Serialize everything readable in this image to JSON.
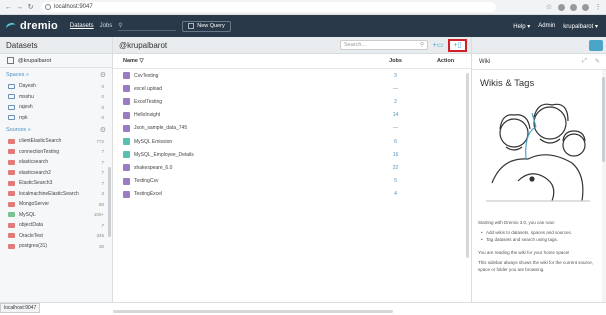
{
  "browser": {
    "url": "localhost:9047",
    "status_url": "localhost:9047"
  },
  "header": {
    "logo": "dremio",
    "nav": [
      "Datasets",
      "Jobs"
    ],
    "new_query": "New Query",
    "help": "Help ▾",
    "admin": "Admin",
    "user": "krupalbarot ▾"
  },
  "left": {
    "title": "Datasets",
    "home": "@krupalbarot",
    "spaces_label": "Spaces »",
    "spaces": [
      {
        "name": "Dayesh",
        "count": "0"
      },
      {
        "name": "msshu",
        "count": "0"
      },
      {
        "name": "rajesh",
        "count": "0"
      },
      {
        "name": "rrpk",
        "count": "0"
      }
    ],
    "sources_label": "Sources »",
    "sources": [
      {
        "name": "clientElasticSearch",
        "count": "772"
      },
      {
        "name": "connectionTesting",
        "count": "7"
      },
      {
        "name": "elasticsearch",
        "count": "7"
      },
      {
        "name": "elasticsearch2",
        "count": "7"
      },
      {
        "name": "ElasticSearch3",
        "count": "7"
      },
      {
        "name": "localmachineElasticSearch",
        "count": "3"
      },
      {
        "name": "MongoServer",
        "count": "80"
      },
      {
        "name": "MySQL",
        "count": "100+"
      },
      {
        "name": "objectData",
        "count": "7"
      },
      {
        "name": "OracleTest",
        "count": "345"
      },
      {
        "name": "postgres(31)",
        "count": "30"
      }
    ]
  },
  "center": {
    "title": "@krupalbarot",
    "search_placeholder": "Search...",
    "col_name": "Name ▽",
    "col_jobs": "Jobs",
    "col_action": "Action",
    "rows": [
      {
        "name": "CsvTesting",
        "jobs": "3",
        "kind": "purple"
      },
      {
        "name": "excel upload",
        "jobs": "—",
        "kind": "purple"
      },
      {
        "name": "ExcelTesting",
        "jobs": "2",
        "kind": "purple"
      },
      {
        "name": "HelloInsight",
        "jobs": "14",
        "kind": "purple"
      },
      {
        "name": "Json_sample_data_745",
        "jobs": "—",
        "kind": "purple"
      },
      {
        "name": "MySQL Emission",
        "jobs": "6",
        "kind": "teal"
      },
      {
        "name": "MySQL_Employee_Details",
        "jobs": "16",
        "kind": "teal"
      },
      {
        "name": "shakespeare_6.0",
        "jobs": "22",
        "kind": "purple"
      },
      {
        "name": "TestingCsv",
        "jobs": "5",
        "kind": "purple"
      },
      {
        "name": "TestingExcel",
        "jobs": "4",
        "kind": "purple"
      }
    ]
  },
  "right": {
    "tab": "Wiki",
    "title": "Wikis & Tags",
    "intro": "Starting with Dremio 3.0, you can now:",
    "bullets": [
      "Add wikis to datasets, spaces and sources.",
      "Tag datasets and search using tags."
    ],
    "p1": "You are reading the wiki for your home space!",
    "p2": "This sidebar always shows the wiki for the current source, space or folder you are browsing."
  }
}
